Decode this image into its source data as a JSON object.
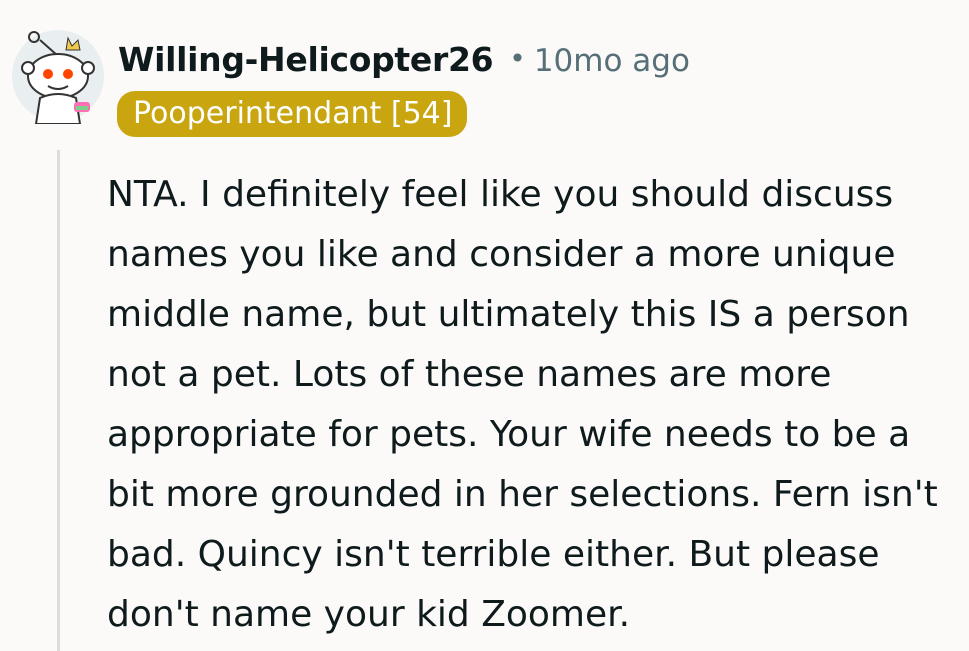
{
  "comment": {
    "author": "Willing-Helicopter26",
    "separator": "•",
    "timestamp": "10mo ago",
    "flair": "Pooperintendant [54]",
    "body": "NTA. I definitely feel like you should discuss names you like and consider a more unique middle name, but ultimately this IS a person not a pet. Lots of these names are more appropriate for pets. Your wife needs to be a bit more grounded in her selections. Fern isn't bad. Quincy isn't terrible either. But please don't name your kid Zoomer."
  },
  "avatar": {
    "icon": "snoo-avatar-icon",
    "background_color": "#e9eef0",
    "accent_color": "#ff4500"
  },
  "colors": {
    "flair_background": "#c9a50f",
    "meta_text": "#576f76",
    "page_background": "#fbfaf9"
  }
}
